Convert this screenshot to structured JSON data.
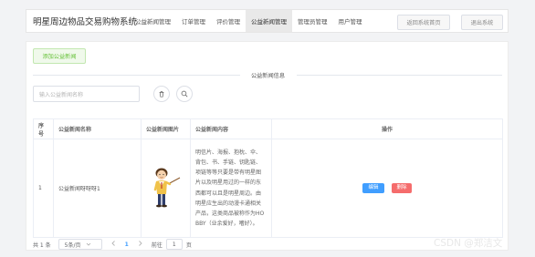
{
  "header": {
    "app_title": "明星周边物品交易购物系统",
    "menu": [
      {
        "label": "公益新闻管理",
        "active": false
      },
      {
        "label": "订单管理",
        "active": false
      },
      {
        "label": "评价管理",
        "active": false
      },
      {
        "label": "公益新闻管理",
        "active": true
      },
      {
        "label": "管理员管理",
        "active": false
      },
      {
        "label": "用户管理",
        "active": false
      }
    ],
    "back_button": "返回系统首页",
    "logout_button": "退出系统"
  },
  "toolbar": {
    "add_button": "添加公益新闻",
    "section_title": "公益新闻信息",
    "search_placeholder": "输入公益新闻名称"
  },
  "table": {
    "headers": [
      "序号",
      "公益新闻名称",
      "公益新闻图片",
      "公益新闻内容",
      "操作"
    ],
    "rows": [
      {
        "index": "1",
        "name": "公益新闻呀呀呀1",
        "content_lines": [
          "明信片、海报、抱枕、伞、",
          "背包、书、手链、钥匙链、",
          "项链等等只要是带有明星图",
          "片以及明星用过的一样的东",
          "西都可以且是明星周边。由",
          "明星应生出的动漫卡通相关",
          "产品，这类商品被称作为HO",
          "BBY（业余爱好，嗜好）。"
        ],
        "edit_label": "编辑",
        "delete_label": "删除"
      }
    ]
  },
  "pagination": {
    "total": "共 1 条",
    "page_size": "5条/页",
    "current_page": "1",
    "goto_label": "前往",
    "goto_value": "1",
    "page_suffix": "页"
  },
  "watermark": "CSDN @郑洁文",
  "colors": {
    "primary": "#409eff",
    "danger": "#f56c6c",
    "success": "#67c23a"
  },
  "icons": [
    "trash-icon",
    "search-icon",
    "chevron-down-icon",
    "chevron-left-icon",
    "chevron-right-icon"
  ]
}
